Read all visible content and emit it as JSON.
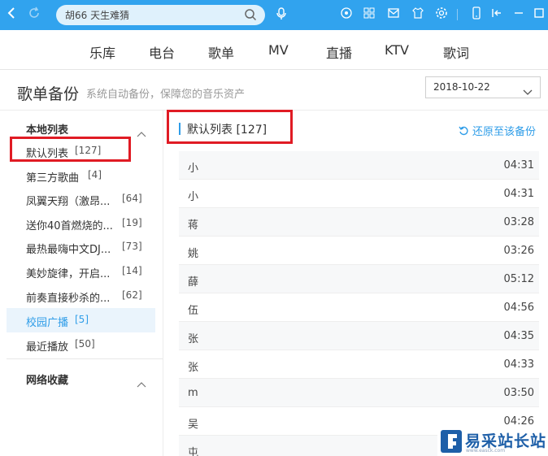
{
  "colors": {
    "accent": "#31a3ee",
    "link": "#2f9de8",
    "highlight_box": "#e01b24"
  },
  "topbar": {
    "search_text": "胡66 天生难猜",
    "icons": [
      "back-icon",
      "refresh-icon",
      "search-icon",
      "microphone-icon",
      "record-icon",
      "apps-icon",
      "mail-icon",
      "skin-icon",
      "settings-icon",
      "phone-icon",
      "mini-mode-icon",
      "maximize-icon"
    ]
  },
  "nav": {
    "items": [
      "乐库",
      "电台",
      "歌单",
      "MV",
      "直播",
      "KTV",
      "歌词"
    ]
  },
  "page": {
    "title": "歌单备份",
    "subtitle": "系统自动备份，保障您的音乐资产",
    "date": "2018-10-22"
  },
  "sidebar": {
    "local_header": "本地列表",
    "items": [
      {
        "label": "默认列表",
        "count": "[127]"
      },
      {
        "label": "第三方歌曲",
        "count": "[4]"
      },
      {
        "label": "凤翼天翔（激昂...",
        "count": "[64]"
      },
      {
        "label": "送你40首燃烧的...",
        "count": "[19]"
      },
      {
        "label": "最热最嗨中文DJ...",
        "count": "[73]"
      },
      {
        "label": "美妙旋律，开启...",
        "count": "[14]"
      },
      {
        "label": "前奏直接秒杀的...",
        "count": "[62]"
      },
      {
        "label": "校园广播",
        "count": "[5]"
      },
      {
        "label": "最近播放",
        "count": "[50]"
      }
    ],
    "network_header": "网络收藏"
  },
  "list": {
    "title": "默认列表 [127]",
    "restore_label": "还原至该备份",
    "songs": [
      {
        "name": "小",
        "duration": "04:31"
      },
      {
        "name": "小",
        "duration": "04:31"
      },
      {
        "name": "蒋",
        "duration": "03:28"
      },
      {
        "name": "姚",
        "duration": "03:26"
      },
      {
        "name": "薛",
        "duration": "05:12"
      },
      {
        "name": "伍",
        "duration": "04:56"
      },
      {
        "name": "张",
        "duration": "04:35"
      },
      {
        "name": "张",
        "duration": "04:33"
      },
      {
        "name": "m",
        "duration": "03:50"
      },
      {
        "name": "吴",
        "duration": "04:26"
      },
      {
        "name": "屯",
        "duration": ""
      }
    ]
  },
  "watermark": {
    "text": "易采站长站",
    "sub": "www.easck.com"
  }
}
